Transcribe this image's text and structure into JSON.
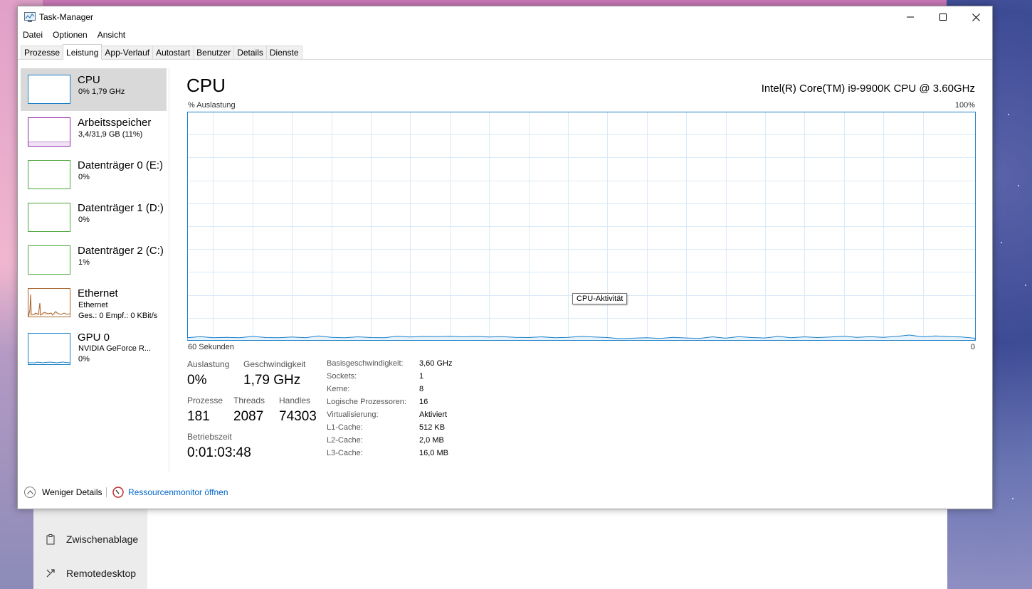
{
  "window": {
    "title": "Task-Manager",
    "menu": [
      "Datei",
      "Optionen",
      "Ansicht"
    ],
    "tabs": [
      "Prozesse",
      "Leistung",
      "App-Verlauf",
      "Autostart",
      "Benutzer",
      "Details",
      "Dienste"
    ],
    "active_tab": "Leistung"
  },
  "sidebar": {
    "items": [
      {
        "title": "CPU",
        "sub": "0%  1,79 GHz",
        "sub2": "",
        "color": "#1a7fc9"
      },
      {
        "title": "Arbeitsspeicher",
        "sub": "3,4/31,9 GB (11%)",
        "sub2": "",
        "color": "#8b2aa8"
      },
      {
        "title": "Datenträger 0 (E:)",
        "sub": "0%",
        "sub2": "",
        "color": "#4ca63a"
      },
      {
        "title": "Datenträger 1 (D:)",
        "sub": "0%",
        "sub2": "",
        "color": "#4ca63a"
      },
      {
        "title": "Datenträger 2 (C:)",
        "sub": "1%",
        "sub2": "",
        "color": "#4ca63a"
      },
      {
        "title": "Ethernet",
        "sub": "Ethernet",
        "sub2": "Ges.: 0  Empf.: 0 KBit/s",
        "color": "#a7632a"
      },
      {
        "title": "GPU 0",
        "sub": "NVIDIA GeForce R...",
        "sub2": "0%",
        "color": "#1a7fc9"
      }
    ]
  },
  "detail": {
    "title": "CPU",
    "model": "Intel(R) Core(TM) i9-9900K CPU @ 3.60GHz",
    "graph_y_label": "% Auslastung",
    "graph_y_max": "100%",
    "graph_x_label": "60 Sekunden",
    "graph_x_min": "0",
    "tooltip": "CPU-Aktivität",
    "stats": {
      "auslastung_label": "Auslastung",
      "auslastung": "0%",
      "geschwindigkeit_label": "Geschwindigkeit",
      "geschwindigkeit": "1,79 GHz",
      "prozesse_label": "Prozesse",
      "prozesse": "181",
      "threads_label": "Threads",
      "threads": "2087",
      "handles_label": "Handles",
      "handles": "74303",
      "betriebszeit_label": "Betriebszeit",
      "betriebszeit": "0:01:03:48"
    },
    "specs": [
      {
        "label": "Basisgeschwindigkeit:",
        "value": "3,60 GHz"
      },
      {
        "label": "Sockets:",
        "value": "1"
      },
      {
        "label": "Kerne:",
        "value": "8"
      },
      {
        "label": "Logische Prozessoren:",
        "value": "16"
      },
      {
        "label": "Virtualisierung:",
        "value": "Aktiviert"
      },
      {
        "label": "L1-Cache:",
        "value": "512 KB"
      },
      {
        "label": "L2-Cache:",
        "value": "2,0 MB"
      },
      {
        "label": "L3-Cache:",
        "value": "16,0 MB"
      }
    ]
  },
  "cpu_history_percent": [
    1,
    1.5,
    1,
    1.2,
    1,
    1.6,
    1.1,
    1,
    1.3,
    1,
    1.8,
    1.2,
    1,
    1.4,
    1.1,
    1,
    1.7,
    1.3,
    1.6,
    1.5,
    1.7,
    1.4,
    1.6,
    1.3,
    1.5,
    1.2,
    1.1,
    1.4,
    1,
    1.2,
    1.6,
    1.3,
    1.1,
    0.6,
    0.8,
    1,
    0.7,
    1.2,
    0.9,
    0.7,
    1.4,
    0.8,
    1.5,
    1.1,
    0.9,
    1.6,
    1,
    1.4,
    1.1,
    1.3,
    1.7,
    1.2,
    1.5,
    1.2,
    1.6,
    2.2,
    1.4,
    1.8,
    1.5,
    1.3,
    0.8
  ],
  "footer": {
    "less_details": "Weniger Details",
    "resource_monitor": "Ressourcenmonitor öffnen"
  },
  "background_window": {
    "items": [
      "Zwischenablage",
      "Remotedesktop"
    ]
  }
}
